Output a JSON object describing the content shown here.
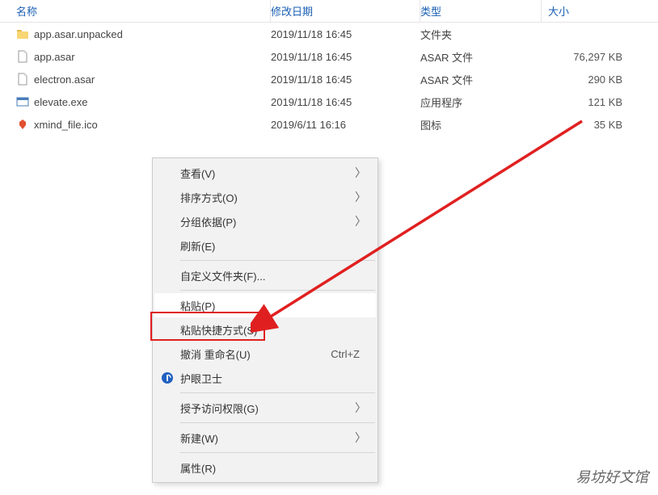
{
  "headers": {
    "name": "名称",
    "date": "修改日期",
    "type": "类型",
    "size": "大小"
  },
  "files": [
    {
      "icon": "folder",
      "name": "app.asar.unpacked",
      "date": "2019/11/18 16:45",
      "type": "文件夹",
      "size": ""
    },
    {
      "icon": "file",
      "name": "app.asar",
      "date": "2019/11/18 16:45",
      "type": "ASAR 文件",
      "size": "76,297 KB"
    },
    {
      "icon": "file",
      "name": "electron.asar",
      "date": "2019/11/18 16:45",
      "type": "ASAR 文件",
      "size": "290 KB"
    },
    {
      "icon": "exe",
      "name": "elevate.exe",
      "date": "2019/11/18 16:45",
      "type": "应用程序",
      "size": "121 KB"
    },
    {
      "icon": "ico",
      "name": "xmind_file.ico",
      "date": "2019/6/11 16:16",
      "type": "图标",
      "size": "35 KB"
    }
  ],
  "menu": [
    {
      "type": "item",
      "label": "查看(V)",
      "submenu": true
    },
    {
      "type": "item",
      "label": "排序方式(O)",
      "submenu": true
    },
    {
      "type": "item",
      "label": "分组依据(P)",
      "submenu": true
    },
    {
      "type": "item",
      "label": "刷新(E)"
    },
    {
      "type": "divider"
    },
    {
      "type": "item",
      "label": "自定义文件夹(F)..."
    },
    {
      "type": "divider"
    },
    {
      "type": "item",
      "label": "粘贴(P)",
      "highlighted": true
    },
    {
      "type": "item",
      "label": "粘贴快捷方式(S)"
    },
    {
      "type": "item",
      "label": "撤消 重命名(U)",
      "shortcut": "Ctrl+Z"
    },
    {
      "type": "item",
      "label": "护眼卫士",
      "icon": "eye"
    },
    {
      "type": "divider"
    },
    {
      "type": "item",
      "label": "授予访问权限(G)",
      "submenu": true
    },
    {
      "type": "divider"
    },
    {
      "type": "item",
      "label": "新建(W)",
      "submenu": true
    },
    {
      "type": "divider"
    },
    {
      "type": "item",
      "label": "属性(R)"
    }
  ],
  "watermark": "易坊好文馆"
}
